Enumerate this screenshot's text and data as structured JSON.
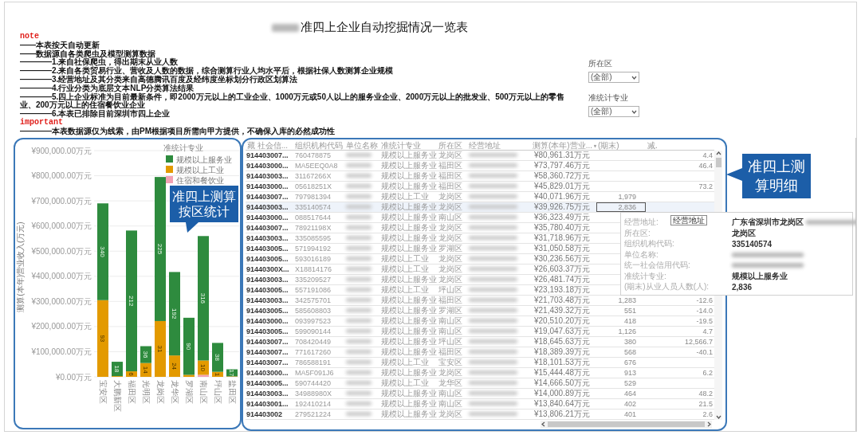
{
  "title": {
    "text": "准四上企业自动挖掘情况一览表",
    "blurred_prefix": true
  },
  "notes": [
    {
      "kind": "heading",
      "text": "note"
    },
    {
      "kind": "line",
      "text": "——本表按天自动更新"
    },
    {
      "kind": "line",
      "text": "——数据源自各类爬虫及模型测算数据"
    },
    {
      "kind": "line",
      "text": "————1.来自社保爬虫，得出期末从业人数"
    },
    {
      "kind": "line",
      "text": "————2.来自各类贸易行业、营收及人数的数据，综合测算行业人均水平后，根据社保人数测算企业规模"
    },
    {
      "kind": "line",
      "text": "————3.经营地址及其分类来自高德腾讯百度及经纬度坐标划分行政区划算法"
    },
    {
      "kind": "line",
      "text": "————4.行业分类为底层文本NLP分类算法结果"
    },
    {
      "kind": "line",
      "text": "————5.四上企业标准为目前最新条件，即2000万元以上的工业企业、1000万元或50人以上的服务业企业、2000万元以上的批发业、500万元以上的零售业、200万元以上的住宿餐饮业企业"
    },
    {
      "kind": "line",
      "text": "————6.本表已排除目前深圳市四上企业"
    },
    {
      "kind": "heading",
      "text": "important"
    },
    {
      "kind": "line",
      "text": "————本表数据源仅为线索，由PM根据项目所需向甲方提供，不确保入库的必然成功性"
    }
  ],
  "filters": [
    {
      "label": "所在区",
      "value": "(全部)"
    },
    {
      "label": "准统计专业",
      "value": "(全部)"
    }
  ],
  "district_chart": {
    "callout": "准四上测算按区统计",
    "segment_counts": [
      {
        "service": "340",
        "industry": "93"
      },
      {
        "service": "18"
      },
      {
        "service": "212",
        "industry": "6"
      },
      {
        "service": "36",
        "industry": "14"
      },
      {
        "service": "225",
        "industry": "31"
      },
      {
        "service": "192",
        "industry": "24"
      },
      {
        "service": "90"
      },
      {
        "service": "316",
        "industry": "10"
      },
      {
        "service": "38",
        "industry": "1"
      },
      {
        "service": "17"
      }
    ],
    "chart_data": {
      "type": "bar",
      "stacked": true,
      "grid": true,
      "ylabel": "测算(本年)营业收入(万元)",
      "legend": {
        "title": "准统计专业"
      },
      "categories": [
        "宝安区",
        "大鹏新区",
        "福田区",
        "光明区",
        "龙岗区",
        "龙华区",
        "罗湖区",
        "南山区",
        "坪山区",
        "盐田区"
      ],
      "ylim": [
        0,
        900000
      ],
      "yticks": [
        {
          "value": 0,
          "label": "¥0.00万元"
        },
        {
          "value": 100000,
          "label": "¥100,000.00万元"
        },
        {
          "value": 200000,
          "label": "¥200,000.00万元"
        },
        {
          "value": 300000,
          "label": "¥300,000.00万元"
        },
        {
          "value": 400000,
          "label": "¥400,000.00万元"
        },
        {
          "value": 500000,
          "label": "¥500,000.00万元"
        },
        {
          "value": 600000,
          "label": "¥600,000.00万元"
        },
        {
          "value": 700000,
          "label": "¥700,000.00万元"
        },
        {
          "value": 800000,
          "label": "¥800,000.00万元"
        },
        {
          "value": 900000,
          "label": "¥900,000.00万元"
        }
      ],
      "series": [
        {
          "name": "规模以上服务业",
          "color": "#2e8b3e",
          "values": [
            385000,
            57000,
            560000,
            67000,
            573000,
            332000,
            227000,
            495000,
            115000,
            28000
          ]
        },
        {
          "name": "规模以上工业",
          "color": "#e39a00",
          "values": [
            305000,
            3000,
            22000,
            55000,
            222000,
            85000,
            8000,
            57000,
            20000,
            2000
          ]
        },
        {
          "name": "住宿和餐饮业",
          "color": "#f2a1b3",
          "values": [
            null,
            null,
            null,
            null,
            null,
            null,
            null,
            8000,
            null,
            null
          ]
        }
      ]
    }
  },
  "detail_table": {
    "callout": "准四上测算明细",
    "columns": [
      {
        "label": "藏 社会信...",
        "kind": "code"
      },
      {
        "label": "组织机构代码",
        "kind": "text"
      },
      {
        "label": "单位名称",
        "kind": "blurred"
      },
      {
        "label": "准统计专业",
        "kind": "cjk"
      },
      {
        "label": "所在区",
        "kind": "cjk"
      },
      {
        "label": "经营地址",
        "kind": "blurred"
      },
      {
        "label": "测算(本年)营业...",
        "kind": "money",
        "filter": true
      },
      {
        "label": "(期末)",
        "kind": "count"
      },
      {
        "label": "减.",
        "kind": "number"
      }
    ],
    "rows": [
      {
        "cells": [
          "914403007...",
          "760478875",
          null,
          "规模以上服务业",
          "龙岗区",
          null,
          "¥80,961.31万元",
          null,
          "4.4"
        ],
        "selected": false
      },
      {
        "cells": [
          "914403000...",
          "MA5EEQ0A8",
          null,
          "规模以上服务业",
          "福田区",
          null,
          "¥73,797.46万元",
          null,
          "46.4"
        ],
        "selected": false
      },
      {
        "cells": [
          "914403003...",
          "31167266X",
          null,
          "规模以上服务业",
          "福田区",
          null,
          "¥58,360.72万元",
          null,
          null
        ],
        "selected": false
      },
      {
        "cells": [
          "914403000...",
          "05618251X",
          null,
          "规模以上服务业",
          "福田区",
          null,
          "¥45,829.01万元",
          null,
          "73.2"
        ],
        "selected": false
      },
      {
        "cells": [
          "914403007...",
          "797981394",
          null,
          "规模以上工业",
          "龙岗区",
          null,
          "¥40,071.96万元",
          "1,979",
          null
        ],
        "selected": false
      },
      {
        "cells": [
          "914403003...",
          "335140574",
          null,
          "规模以上服务业",
          "龙岗区",
          null,
          "¥39,926.75万元",
          "2,836",
          null
        ],
        "selected": true
      },
      {
        "cells": [
          "914403000...",
          "088517644",
          null,
          "规模以上服务业",
          "南山区",
          null,
          "¥36,323.49万元",
          null,
          null
        ],
        "selected": false
      },
      {
        "cells": [
          "914403007...",
          "78921198X",
          null,
          "规模以上服务业",
          "龙岗区",
          null,
          "¥35,780.40万元",
          null,
          null
        ],
        "selected": false
      },
      {
        "cells": [
          "914403003...",
          "335085595",
          null,
          "规模以上服务业",
          "龙岗区",
          null,
          "¥31,718.96万元",
          null,
          null
        ],
        "selected": false
      },
      {
        "cells": [
          "914403005...",
          "571994192",
          null,
          "规模以上服务业",
          "罗湖区",
          null,
          "¥31,050.58万元",
          null,
          null
        ],
        "selected": false
      },
      {
        "cells": [
          "914403005...",
          "593016189",
          null,
          "规模以上工业",
          "龙岗区",
          null,
          "¥30,236.56万元",
          null,
          null
        ],
        "selected": false
      },
      {
        "cells": [
          "91440300X...",
          "X18814176",
          null,
          "规模以上工业",
          "龙岗区",
          null,
          "¥26,603.37万元",
          null,
          null
        ],
        "selected": false
      },
      {
        "cells": [
          "914403003...",
          "335209527",
          null,
          "规模以上服务业",
          "龙岗区",
          null,
          "¥26,481.74万元",
          null,
          null
        ],
        "selected": false
      },
      {
        "cells": [
          "914403005...",
          "557191086",
          null,
          "规模以上工业",
          "坪山区",
          null,
          "¥23,193.18万元",
          null,
          null
        ],
        "selected": false
      },
      {
        "cells": [
          "914403003...",
          "342575701",
          null,
          "规模以上服务业",
          "福田区",
          null,
          "¥21,703.48万元",
          "1,283",
          "-12.6"
        ],
        "selected": false
      },
      {
        "cells": [
          "914403005...",
          "585608803",
          null,
          "规模以上服务业",
          "罗湖区",
          null,
          "¥21,439.32万元",
          "551",
          "-14.0"
        ],
        "selected": false
      },
      {
        "cells": [
          "914403000...",
          "093997523",
          null,
          "规模以上服务业",
          "南山区",
          null,
          "¥20,510.20万元",
          "418",
          "-19.5"
        ],
        "selected": false
      },
      {
        "cells": [
          "914403005...",
          "599090144",
          null,
          "规模以上服务业",
          "南山区",
          null,
          "¥19,047.63万元",
          "1,126",
          "4.7"
        ],
        "selected": false
      },
      {
        "cells": [
          "914403007...",
          "708420449",
          null,
          "规模以上服务业",
          "坪山区",
          null,
          "¥18,645.63万元",
          "380",
          "12,566.7"
        ],
        "selected": false
      },
      {
        "cells": [
          "914403007...",
          "771617260",
          null,
          "规模以上服务业",
          "福田区",
          null,
          "¥18,389.39万元",
          "568",
          "-40.1"
        ],
        "selected": false
      },
      {
        "cells": [
          "914403007...",
          "786588191",
          null,
          "规模以上工业",
          "宝安区",
          null,
          "¥18,101.53万元",
          "676",
          null
        ],
        "selected": false
      },
      {
        "cells": [
          "914403000...",
          "MA5F091J6",
          null,
          "规模以上服务业",
          "龙岗区",
          null,
          "¥15,444.48万元",
          "913",
          "6.2"
        ],
        "selected": false
      },
      {
        "cells": [
          "914403005...",
          "590744420",
          null,
          "规模以上工业",
          "龙华区",
          null,
          "¥14,666.50万元",
          "529",
          null
        ],
        "selected": false
      },
      {
        "cells": [
          "914403003...",
          "34988980X",
          null,
          "规模以上服务业",
          "南山区",
          null,
          "¥14,000.89万元",
          "464",
          "48.2"
        ],
        "selected": false
      },
      {
        "cells": [
          "914403001...",
          "192410214",
          null,
          "规模以上服务业",
          "南山区",
          null,
          "¥13,840.64万元",
          "402",
          "21.5"
        ],
        "selected": false
      },
      {
        "cells": [
          "914403002",
          "279521224",
          null,
          "规模以上服务业",
          "龙岗区",
          null,
          "¥13,806.21万元",
          "401",
          "2.6"
        ],
        "selected": false
      }
    ],
    "tooltip": {
      "hover_label": "经营地址",
      "items": [
        {
          "label": "经营地址:",
          "value": "广东省深圳市龙岗区",
          "blurred_tail": true
        },
        {
          "label": "所在区:",
          "value": "龙岗区"
        },
        {
          "label": "组织机构代码:",
          "value": "335140574"
        },
        {
          "label": "单位名称:",
          "blurred_tail": true
        },
        {
          "label": "统一社会信用代码:",
          "blurred_tail": true
        },
        {
          "label": "准统计专业:",
          "value": "规模以上服务业"
        },
        {
          "label": "(期末)从业人员人数(人):",
          "value": "2,836"
        }
      ]
    }
  }
}
